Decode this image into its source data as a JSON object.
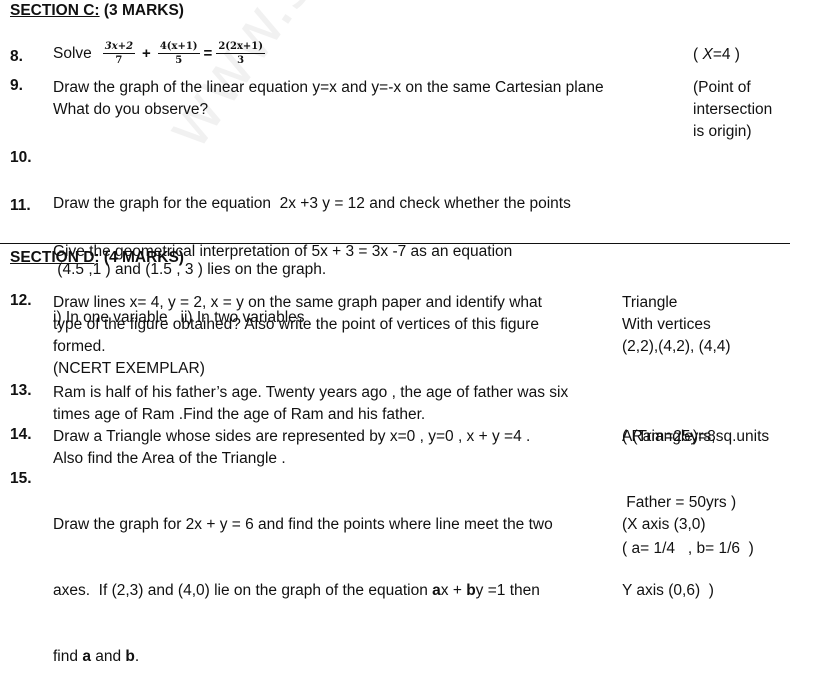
{
  "watermark": "www.studiestoday",
  "section_c": {
    "title_underlined": "SECTION C:",
    "title_rest": " (3 MARKS)"
  },
  "section_d": {
    "title_underlined": "SECTION D",
    "title_rest": ": (4 MARKS)"
  },
  "questions": {
    "q8": {
      "number": "8.",
      "solve": "Solve",
      "frac1_num": "3x+2",
      "frac1_den": "7",
      "plus": "+",
      "frac2_num": "4(x+1)",
      "frac2_den": "5",
      "equals": "=",
      "frac3_num": "2(2x+1)",
      "frac3_den": "3",
      "answer_open": "(  ",
      "answer_var": "X",
      "answer_rest": "=4 )"
    },
    "q9": {
      "number": "9.",
      "lines": [
        "Draw the graph of  the linear equation y=x and y=-x on the same Cartesian plane",
        "What do you observe?"
      ],
      "answer": [
        "(Point of",
        "intersection",
        "is origin)"
      ]
    },
    "q10": {
      "number": "10.",
      "lines": [
        "Draw the graph for the equation  2x +3 y = 12 and check whether the points",
        " (4.5 ,1 ) and (1.5 , 3 ) lies on the graph."
      ]
    },
    "q11": {
      "number": "11.",
      "lines": [
        "Give the geometrical interpretation of 5x + 3 = 3x -7 as an equation",
        "i) In one variable   ii) In two variables"
      ]
    },
    "q12": {
      "number": "12.",
      "lines": [
        "Draw lines x= 4, y = 2, x = y on the same graph paper and identify what",
        "type of the figure obtained? Also write the point of vertices of this figure",
        "formed.",
        "(NCERT EXEMPLAR)"
      ],
      "answer": [
        "Triangle",
        "With vertices",
        "(2,2),(4,2), (4,4)"
      ]
    },
    "q13": {
      "number": "13.",
      "lines": [
        "Ram is half of his father’s age. Twenty years ago , the age of father was six",
        "times age of Ram .Find the age of Ram and his father."
      ],
      "answer": [
        "( Ram=25yrs,",
        " Father = 50yrs )"
      ]
    },
    "q14": {
      "number": "14.",
      "lines": [
        "Draw a Triangle whose sides are represented by x=0 , y=0 , x + y =4 .",
        "Also find the Area of the Triangle ."
      ],
      "answer": [
        "A(Triangle)=8sq.units"
      ]
    },
    "q15": {
      "number": "15.",
      "line1": "Draw the graph for 2x + y = 6 and find the points where line meet the two",
      "line2_a": "axes.  If (2,3) and (4,0) lie on the graph of the equation ",
      "line2_b_a": "a",
      "line2_c": "x + ",
      "line2_d_b": "b",
      "line2_e": "y =1 then",
      "line3_a": "find ",
      "line3_b_a": "a",
      "line3_c": " and ",
      "line3_d_b": "b",
      "line3_e": ".",
      "answer": [
        "(X axis (3,0)",
        "Y axis (0,6)  )"
      ],
      "answer2": "( a= 1/4   , b= 1/6  )"
    }
  }
}
